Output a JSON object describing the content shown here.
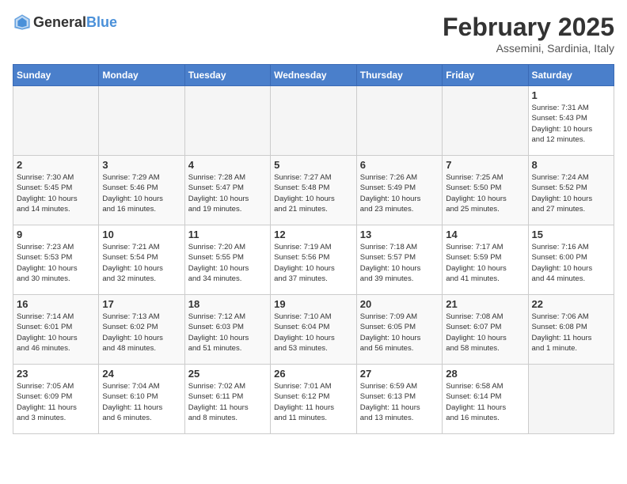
{
  "header": {
    "logo_general": "General",
    "logo_blue": "Blue",
    "month_title": "February 2025",
    "subtitle": "Assemini, Sardinia, Italy"
  },
  "weekdays": [
    "Sunday",
    "Monday",
    "Tuesday",
    "Wednesday",
    "Thursday",
    "Friday",
    "Saturday"
  ],
  "weeks": [
    [
      {
        "day": "",
        "info": ""
      },
      {
        "day": "",
        "info": ""
      },
      {
        "day": "",
        "info": ""
      },
      {
        "day": "",
        "info": ""
      },
      {
        "day": "",
        "info": ""
      },
      {
        "day": "",
        "info": ""
      },
      {
        "day": "1",
        "info": "Sunrise: 7:31 AM\nSunset: 5:43 PM\nDaylight: 10 hours\nand 12 minutes."
      }
    ],
    [
      {
        "day": "2",
        "info": "Sunrise: 7:30 AM\nSunset: 5:45 PM\nDaylight: 10 hours\nand 14 minutes."
      },
      {
        "day": "3",
        "info": "Sunrise: 7:29 AM\nSunset: 5:46 PM\nDaylight: 10 hours\nand 16 minutes."
      },
      {
        "day": "4",
        "info": "Sunrise: 7:28 AM\nSunset: 5:47 PM\nDaylight: 10 hours\nand 19 minutes."
      },
      {
        "day": "5",
        "info": "Sunrise: 7:27 AM\nSunset: 5:48 PM\nDaylight: 10 hours\nand 21 minutes."
      },
      {
        "day": "6",
        "info": "Sunrise: 7:26 AM\nSunset: 5:49 PM\nDaylight: 10 hours\nand 23 minutes."
      },
      {
        "day": "7",
        "info": "Sunrise: 7:25 AM\nSunset: 5:50 PM\nDaylight: 10 hours\nand 25 minutes."
      },
      {
        "day": "8",
        "info": "Sunrise: 7:24 AM\nSunset: 5:52 PM\nDaylight: 10 hours\nand 27 minutes."
      }
    ],
    [
      {
        "day": "9",
        "info": "Sunrise: 7:23 AM\nSunset: 5:53 PM\nDaylight: 10 hours\nand 30 minutes."
      },
      {
        "day": "10",
        "info": "Sunrise: 7:21 AM\nSunset: 5:54 PM\nDaylight: 10 hours\nand 32 minutes."
      },
      {
        "day": "11",
        "info": "Sunrise: 7:20 AM\nSunset: 5:55 PM\nDaylight: 10 hours\nand 34 minutes."
      },
      {
        "day": "12",
        "info": "Sunrise: 7:19 AM\nSunset: 5:56 PM\nDaylight: 10 hours\nand 37 minutes."
      },
      {
        "day": "13",
        "info": "Sunrise: 7:18 AM\nSunset: 5:57 PM\nDaylight: 10 hours\nand 39 minutes."
      },
      {
        "day": "14",
        "info": "Sunrise: 7:17 AM\nSunset: 5:59 PM\nDaylight: 10 hours\nand 41 minutes."
      },
      {
        "day": "15",
        "info": "Sunrise: 7:16 AM\nSunset: 6:00 PM\nDaylight: 10 hours\nand 44 minutes."
      }
    ],
    [
      {
        "day": "16",
        "info": "Sunrise: 7:14 AM\nSunset: 6:01 PM\nDaylight: 10 hours\nand 46 minutes."
      },
      {
        "day": "17",
        "info": "Sunrise: 7:13 AM\nSunset: 6:02 PM\nDaylight: 10 hours\nand 48 minutes."
      },
      {
        "day": "18",
        "info": "Sunrise: 7:12 AM\nSunset: 6:03 PM\nDaylight: 10 hours\nand 51 minutes."
      },
      {
        "day": "19",
        "info": "Sunrise: 7:10 AM\nSunset: 6:04 PM\nDaylight: 10 hours\nand 53 minutes."
      },
      {
        "day": "20",
        "info": "Sunrise: 7:09 AM\nSunset: 6:05 PM\nDaylight: 10 hours\nand 56 minutes."
      },
      {
        "day": "21",
        "info": "Sunrise: 7:08 AM\nSunset: 6:07 PM\nDaylight: 10 hours\nand 58 minutes."
      },
      {
        "day": "22",
        "info": "Sunrise: 7:06 AM\nSunset: 6:08 PM\nDaylight: 11 hours\nand 1 minute."
      }
    ],
    [
      {
        "day": "23",
        "info": "Sunrise: 7:05 AM\nSunset: 6:09 PM\nDaylight: 11 hours\nand 3 minutes."
      },
      {
        "day": "24",
        "info": "Sunrise: 7:04 AM\nSunset: 6:10 PM\nDaylight: 11 hours\nand 6 minutes."
      },
      {
        "day": "25",
        "info": "Sunrise: 7:02 AM\nSunset: 6:11 PM\nDaylight: 11 hours\nand 8 minutes."
      },
      {
        "day": "26",
        "info": "Sunrise: 7:01 AM\nSunset: 6:12 PM\nDaylight: 11 hours\nand 11 minutes."
      },
      {
        "day": "27",
        "info": "Sunrise: 6:59 AM\nSunset: 6:13 PM\nDaylight: 11 hours\nand 13 minutes."
      },
      {
        "day": "28",
        "info": "Sunrise: 6:58 AM\nSunset: 6:14 PM\nDaylight: 11 hours\nand 16 minutes."
      },
      {
        "day": "",
        "info": ""
      }
    ]
  ]
}
